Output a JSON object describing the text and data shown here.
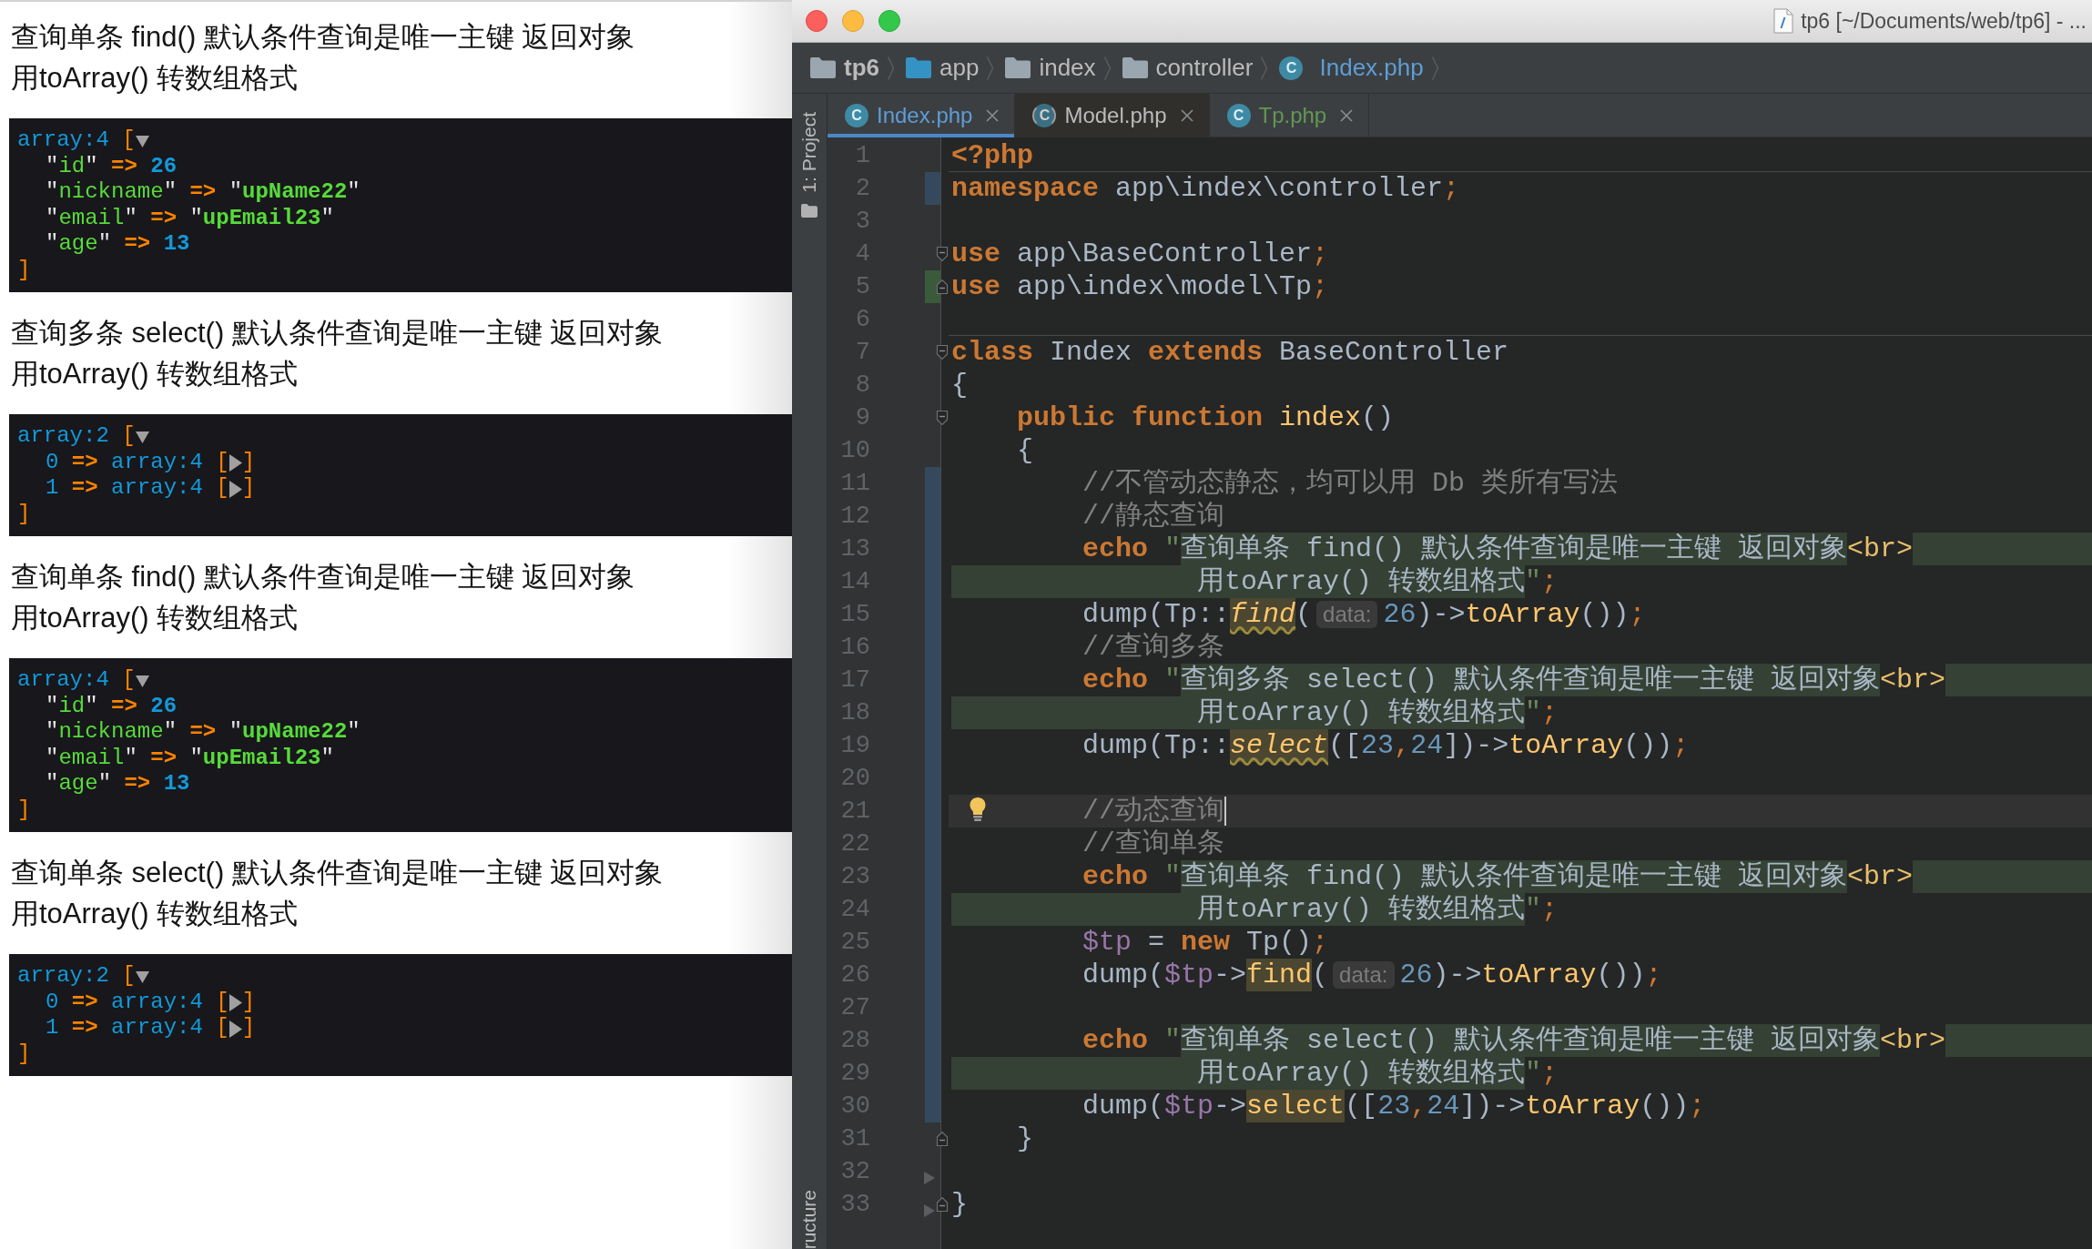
{
  "browser": {
    "sections": [
      {
        "heading": [
          "查询单条 find() 默认条件查询是唯一主键 返回对象",
          "用toArray() 转数组格式"
        ],
        "dump": {
          "label": "array:4",
          "open": "[",
          "expanded": true,
          "entries": [
            {
              "key": {
                "text": "\"id\"",
                "kind": "string"
              },
              "arrow": "=>",
              "kind": "number",
              "value": "26"
            },
            {
              "key": {
                "text": "\"nickname\"",
                "kind": "string"
              },
              "arrow": "=>",
              "kind": "string",
              "value": "\"upName22\""
            },
            {
              "key": {
                "text": "\"email\"",
                "kind": "string"
              },
              "arrow": "=>",
              "kind": "string",
              "value": "\"upEmail23\""
            },
            {
              "key": {
                "text": "\"age\"",
                "kind": "string"
              },
              "arrow": "=>",
              "kind": "number",
              "value": "13"
            }
          ],
          "close": "]"
        }
      },
      {
        "heading": [
          "查询多条 select() 默认条件查询是唯一主键 返回对象",
          "用toArray() 转数组格式"
        ],
        "dump": {
          "label": "array:2",
          "open": "[",
          "expanded": true,
          "entries": [
            {
              "key": {
                "text": "0",
                "kind": "index"
              },
              "arrow": "=>",
              "kind": "array",
              "value": "array:4",
              "open": "[",
              "expanded": false,
              "close": "]"
            },
            {
              "key": {
                "text": "1",
                "kind": "index"
              },
              "arrow": "=>",
              "kind": "array",
              "value": "array:4",
              "open": "[",
              "expanded": false,
              "close": "]"
            }
          ],
          "close": "]"
        }
      },
      {
        "heading": [
          "查询单条 find() 默认条件查询是唯一主键 返回对象",
          "用toArray() 转数组格式"
        ],
        "dump": {
          "label": "array:4",
          "open": "[",
          "expanded": true,
          "entries": [
            {
              "key": {
                "text": "\"id\"",
                "kind": "string"
              },
              "arrow": "=>",
              "kind": "number",
              "value": "26"
            },
            {
              "key": {
                "text": "\"nickname\"",
                "kind": "string"
              },
              "arrow": "=>",
              "kind": "string",
              "value": "\"upName22\""
            },
            {
              "key": {
                "text": "\"email\"",
                "kind": "string"
              },
              "arrow": "=>",
              "kind": "string",
              "value": "\"upEmail23\""
            },
            {
              "key": {
                "text": "\"age\"",
                "kind": "string"
              },
              "arrow": "=>",
              "kind": "number",
              "value": "13"
            }
          ],
          "close": "]"
        }
      },
      {
        "heading": [
          "查询单条 select() 默认条件查询是唯一主键 返回对象",
          "用toArray() 转数组格式"
        ],
        "dump": {
          "label": "array:2",
          "open": "[",
          "expanded": true,
          "entries": [
            {
              "key": {
                "text": "0",
                "kind": "index"
              },
              "arrow": "=>",
              "kind": "array",
              "value": "array:4",
              "open": "[",
              "expanded": false,
              "close": "]"
            },
            {
              "key": {
                "text": "1",
                "kind": "index"
              },
              "arrow": "=>",
              "kind": "array",
              "value": "array:4",
              "open": "[",
              "expanded": false,
              "close": "]"
            }
          ],
          "close": "]"
        }
      }
    ]
  },
  "ide": {
    "title_bar": {
      "title": "tp6 [~/Documents/web/tp6] - ..."
    },
    "breadcrumbs": [
      {
        "label": "tp6",
        "kind": "project",
        "color": "#bbbbbb"
      },
      {
        "label": "app",
        "kind": "source_folder",
        "color": "#bbbbbb"
      },
      {
        "label": "index",
        "kind": "folder",
        "color": "#bbbbbb"
      },
      {
        "label": "controller",
        "kind": "folder",
        "color": "#bbbbbb"
      },
      {
        "label": "Index.php",
        "kind": "class",
        "icon_letter": "C",
        "color": "#5e9dd6"
      }
    ],
    "tool_strip": {
      "top": {
        "label": "1: Project"
      },
      "bottom": {
        "label": "ructure"
      }
    },
    "tabs": [
      {
        "label": "Index.php",
        "kind": "class",
        "icon_letter": "C",
        "color": "#5e9dd6",
        "selected": true,
        "hovered": false
      },
      {
        "label": "Model.php",
        "kind": "abstract_class",
        "icon_letter": "C",
        "color": "#bbbbbb",
        "selected": false,
        "hovered": true
      },
      {
        "label": "Tp.php",
        "kind": "class",
        "icon_letter": "C",
        "color": "#629755",
        "selected": false,
        "hovered": false
      }
    ],
    "lines": [
      {
        "number": "1",
        "current": false,
        "separator_after": true,
        "tokens": [
          {
            "text": "<?php",
            "kind": "kw"
          }
        ]
      },
      {
        "number": "2",
        "current": false,
        "change": {
          "kind": "modified"
        },
        "tokens": [
          {
            "text": "namespace",
            "kind": "kw"
          },
          {
            "text": " app\\index\\controller",
            "kind": "id"
          },
          {
            "text": ";",
            "kind": "semi"
          }
        ]
      },
      {
        "number": "3",
        "current": false
      },
      {
        "number": "4",
        "current": false,
        "fold": {
          "kind": "start"
        },
        "tokens": [
          {
            "text": "use",
            "kind": "kw"
          },
          {
            "text": " app\\BaseController",
            "kind": "id"
          },
          {
            "text": ";",
            "kind": "semi"
          }
        ]
      },
      {
        "number": "5",
        "current": false,
        "fold": {
          "kind": "end"
        },
        "change": {
          "kind": "added"
        },
        "tokens": [
          {
            "text": "use",
            "kind": "kw"
          },
          {
            "text": " app\\index\\model\\Tp",
            "kind": "id"
          },
          {
            "text": ";",
            "kind": "semi"
          }
        ]
      },
      {
        "number": "6",
        "current": false,
        "separator_after": true
      },
      {
        "number": "7",
        "current": false,
        "fold": {
          "kind": "start"
        },
        "tokens": [
          {
            "text": "class",
            "kind": "kw"
          },
          {
            "text": " Index ",
            "kind": "id"
          },
          {
            "text": "extends",
            "kind": "kw"
          },
          {
            "text": " BaseController",
            "kind": "id"
          }
        ]
      },
      {
        "number": "8",
        "current": false,
        "tokens": [
          {
            "text": "{",
            "kind": "id"
          }
        ]
      },
      {
        "number": "9",
        "current": false,
        "fold": {
          "kind": "start"
        },
        "tokens": [
          {
            "text": "    public function",
            "kind": "kw"
          },
          {
            "text": " index",
            "kind": "fn"
          },
          {
            "text": "()",
            "kind": "id"
          }
        ]
      },
      {
        "number": "10",
        "current": false,
        "tokens": [
          {
            "text": "    {",
            "kind": "id"
          }
        ]
      },
      {
        "number": "11",
        "current": false,
        "change": {
          "kind": "modified"
        },
        "tokens": [
          {
            "text": "        //不管动态静态，均可以用 Db 类所有写法",
            "kind": "cm"
          }
        ]
      },
      {
        "number": "12",
        "current": false,
        "change": {
          "kind": "modified"
        },
        "tokens": [
          {
            "text": "        //静态查询",
            "kind": "cm"
          }
        ]
      },
      {
        "number": "13",
        "current": false,
        "change": {
          "kind": "modified"
        },
        "string_continues": true,
        "tokens": [
          {
            "text": "        echo",
            "kind": "kw"
          },
          {
            "text": " \"",
            "kind": "q"
          },
          {
            "text": "查询单条 find() 默认条件查询是唯一主键 返回对象",
            "kind": "str"
          },
          {
            "text": "<br>",
            "kind": "tag"
          }
        ]
      },
      {
        "number": "14",
        "current": false,
        "change": {
          "kind": "modified"
        },
        "tokens": [
          {
            "text": "               用toArray() 转数组格式",
            "kind": "str"
          },
          {
            "text": "\"",
            "kind": "q"
          },
          {
            "text": ";",
            "kind": "semi"
          }
        ]
      },
      {
        "number": "15",
        "current": false,
        "change": {
          "kind": "modified"
        },
        "tokens": [
          {
            "text": "        dump(Tp::",
            "kind": "id"
          },
          {
            "text": "find",
            "kind": "call_static"
          },
          {
            "text": "(",
            "kind": "id"
          },
          {
            "text": "data:",
            "kind": "hint"
          },
          {
            "text": "26",
            "kind": "num"
          },
          {
            "text": ")->",
            "kind": "id"
          },
          {
            "text": "toArray",
            "kind": "call"
          },
          {
            "text": "())",
            "kind": "id"
          },
          {
            "text": ";",
            "kind": "semi"
          }
        ]
      },
      {
        "number": "16",
        "current": false,
        "change": {
          "kind": "modified"
        },
        "tokens": [
          {
            "text": "        //查询多条",
            "kind": "cm"
          }
        ]
      },
      {
        "number": "17",
        "current": false,
        "change": {
          "kind": "modified"
        },
        "string_continues": true,
        "tokens": [
          {
            "text": "        echo",
            "kind": "kw"
          },
          {
            "text": " \"",
            "kind": "q"
          },
          {
            "text": "查询多条 select() 默认条件查询是唯一主键 返回对象",
            "kind": "str"
          },
          {
            "text": "<br>",
            "kind": "tag"
          }
        ]
      },
      {
        "number": "18",
        "current": false,
        "change": {
          "kind": "modified"
        },
        "tokens": [
          {
            "text": "               用toArray() 转数组格式",
            "kind": "str"
          },
          {
            "text": "\"",
            "kind": "q"
          },
          {
            "text": ";",
            "kind": "semi"
          }
        ]
      },
      {
        "number": "19",
        "current": false,
        "change": {
          "kind": "modified"
        },
        "tokens": [
          {
            "text": "        dump(Tp::",
            "kind": "id"
          },
          {
            "text": "select",
            "kind": "call_static"
          },
          {
            "text": "([",
            "kind": "id"
          },
          {
            "text": "23",
            "kind": "num"
          },
          {
            "text": ",",
            "kind": "semi"
          },
          {
            "text": "24",
            "kind": "num"
          },
          {
            "text": "])->",
            "kind": "id"
          },
          {
            "text": "toArray",
            "kind": "call"
          },
          {
            "text": "())",
            "kind": "id"
          },
          {
            "text": ";",
            "kind": "semi"
          }
        ]
      },
      {
        "number": "20",
        "current": false,
        "change": {
          "kind": "modified"
        }
      },
      {
        "number": "21",
        "current": true,
        "change": {
          "kind": "modified"
        },
        "gutter_icon": {
          "kind": "bulb"
        },
        "tokens": [
          {
            "text": "        //动态查询",
            "kind": "cm"
          }
        ]
      },
      {
        "number": "22",
        "current": false,
        "change": {
          "kind": "modified"
        },
        "tokens": [
          {
            "text": "        //查询单条",
            "kind": "cm"
          }
        ]
      },
      {
        "number": "23",
        "current": false,
        "change": {
          "kind": "modified"
        },
        "string_continues": true,
        "tokens": [
          {
            "text": "        echo",
            "kind": "kw"
          },
          {
            "text": " \"",
            "kind": "q"
          },
          {
            "text": "查询单条 find() 默认条件查询是唯一主键 返回对象",
            "kind": "str"
          },
          {
            "text": "<br>",
            "kind": "tag"
          }
        ]
      },
      {
        "number": "24",
        "current": false,
        "change": {
          "kind": "modified"
        },
        "tokens": [
          {
            "text": "               用toArray() 转数组格式",
            "kind": "str"
          },
          {
            "text": "\"",
            "kind": "q"
          },
          {
            "text": ";",
            "kind": "semi"
          }
        ]
      },
      {
        "number": "25",
        "current": false,
        "change": {
          "kind": "modified"
        },
        "tokens": [
          {
            "text": "        $tp",
            "kind": "var"
          },
          {
            "text": " = ",
            "kind": "id"
          },
          {
            "text": "new",
            "kind": "kw"
          },
          {
            "text": " Tp()",
            "kind": "id"
          },
          {
            "text": ";",
            "kind": "semi"
          }
        ]
      },
      {
        "number": "26",
        "current": false,
        "change": {
          "kind": "modified"
        },
        "tokens": [
          {
            "text": "        dump(",
            "kind": "id"
          },
          {
            "text": "$tp",
            "kind": "var"
          },
          {
            "text": "->",
            "kind": "id"
          },
          {
            "text": "find",
            "kind": "call_warn"
          },
          {
            "text": "(",
            "kind": "id"
          },
          {
            "text": "data:",
            "kind": "hint"
          },
          {
            "text": "26",
            "kind": "num"
          },
          {
            "text": ")->",
            "kind": "id"
          },
          {
            "text": "toArray",
            "kind": "call"
          },
          {
            "text": "())",
            "kind": "id"
          },
          {
            "text": ";",
            "kind": "semi"
          }
        ]
      },
      {
        "number": "27",
        "current": false,
        "change": {
          "kind": "modified"
        }
      },
      {
        "number": "28",
        "current": false,
        "change": {
          "kind": "modified"
        },
        "string_continues": true,
        "tokens": [
          {
            "text": "        echo",
            "kind": "kw"
          },
          {
            "text": " \"",
            "kind": "q"
          },
          {
            "text": "查询单条 select() 默认条件查询是唯一主键 返回对象",
            "kind": "str"
          },
          {
            "text": "<br>",
            "kind": "tag"
          }
        ]
      },
      {
        "number": "29",
        "current": false,
        "change": {
          "kind": "modified"
        },
        "tokens": [
          {
            "text": "               用toArray() 转数组格式",
            "kind": "str"
          },
          {
            "text": "\"",
            "kind": "q"
          },
          {
            "text": ";",
            "kind": "semi"
          }
        ]
      },
      {
        "number": "30",
        "current": false,
        "change": {
          "kind": "modified"
        },
        "tokens": [
          {
            "text": "        dump(",
            "kind": "id"
          },
          {
            "text": "$tp",
            "kind": "var"
          },
          {
            "text": "->",
            "kind": "id"
          },
          {
            "text": "select",
            "kind": "call_warn"
          },
          {
            "text": "([",
            "kind": "id"
          },
          {
            "text": "23",
            "kind": "num"
          },
          {
            "text": ",",
            "kind": "semi"
          },
          {
            "text": "24",
            "kind": "num"
          },
          {
            "text": "])->",
            "kind": "id"
          },
          {
            "text": "toArray",
            "kind": "call"
          },
          {
            "text": "())",
            "kind": "id"
          },
          {
            "text": ";",
            "kind": "semi"
          }
        ]
      },
      {
        "number": "31",
        "current": false,
        "fold": {
          "kind": "end"
        },
        "tokens": [
          {
            "text": "    }",
            "kind": "id"
          }
        ]
      },
      {
        "number": "32",
        "current": false,
        "gutter_icon": {
          "kind": "triangle"
        }
      },
      {
        "number": "33",
        "current": false,
        "fold": {
          "kind": "end"
        },
        "gutter_icon": {
          "kind": "triangle"
        },
        "tokens": [
          {
            "text": "}",
            "kind": "id"
          }
        ]
      }
    ]
  }
}
